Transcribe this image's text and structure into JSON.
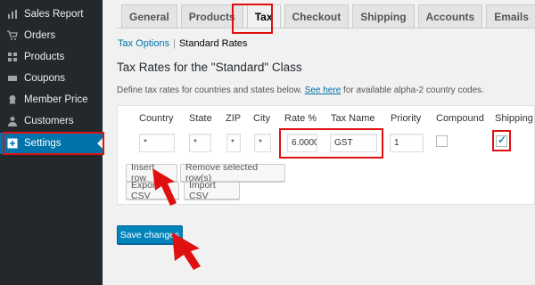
{
  "sidebar": {
    "items": [
      {
        "label": "Sales Report",
        "icon": "bar-chart-icon"
      },
      {
        "label": "Orders",
        "icon": "cart-icon"
      },
      {
        "label": "Products",
        "icon": "grid-icon"
      },
      {
        "label": "Coupons",
        "icon": "ticket-icon"
      },
      {
        "label": "Member Price",
        "icon": "ribbon-icon"
      },
      {
        "label": "Customers",
        "icon": "user-icon"
      },
      {
        "label": "Settings",
        "icon": "plus-box-icon",
        "active": true
      }
    ]
  },
  "tabs": [
    "General",
    "Products",
    "Tax",
    "Checkout",
    "Shipping",
    "Accounts",
    "Emails"
  ],
  "active_tab": "Tax",
  "subnav": {
    "link": "Tax Options",
    "current": "Standard Rates"
  },
  "section": {
    "title": "Tax Rates for the \"Standard\" Class",
    "desc_before": "Define tax rates for countries and states below.",
    "desc_link": "See here",
    "desc_after": "for available alpha-2 country codes."
  },
  "table": {
    "headers": [
      "Country",
      "State",
      "ZIP",
      "City",
      "Rate %",
      "Tax Name",
      "Priority",
      "Compound",
      "Shipping"
    ],
    "row": {
      "country": "*",
      "state": "*",
      "zip": "*",
      "city": "*",
      "rate": "6.0000",
      "tax_name": "GST",
      "priority": "1",
      "compound": false,
      "shipping": true
    }
  },
  "buttons": {
    "insert": "Insert row",
    "remove": "Remove selected row(s)",
    "export": "Export CSV",
    "import": "Import CSV",
    "save": "Save changes"
  },
  "colors": {
    "highlight": "#e01010",
    "accent": "#0073aa",
    "sidebar": "#23282d"
  }
}
